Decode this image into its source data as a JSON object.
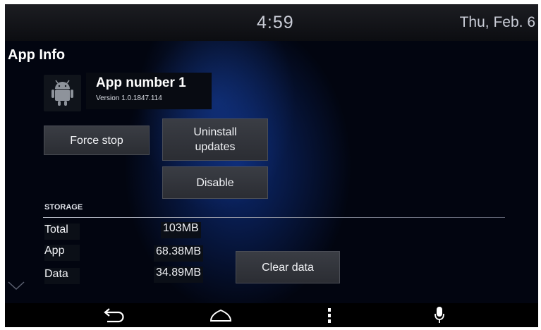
{
  "status_bar": {
    "time": "4:59",
    "date": "Thu, Feb. 6"
  },
  "page": {
    "title": "App Info"
  },
  "app": {
    "name": "App number 1",
    "version": "Version  1.0.1847.114",
    "icon": "android-robot-icon"
  },
  "buttons": {
    "force_stop": "Force stop",
    "uninstall_updates": "Uninstall updates",
    "disable": "Disable",
    "clear_data": "Clear data"
  },
  "storage": {
    "section_label": "STORAGE",
    "rows": [
      {
        "label": "Total",
        "value": "103MB"
      },
      {
        "label": "App",
        "value": "68.38MB"
      },
      {
        "label": "Data",
        "value": "34.89MB"
      }
    ]
  },
  "nav": {
    "icons": [
      "chevron-down-icon",
      "back-icon",
      "home-icon",
      "menu-icon",
      "microphone-icon"
    ]
  },
  "colors": {
    "background": "#020510",
    "accent_glow": "#1446be",
    "button": "#33363c",
    "text": "#ffffff"
  }
}
